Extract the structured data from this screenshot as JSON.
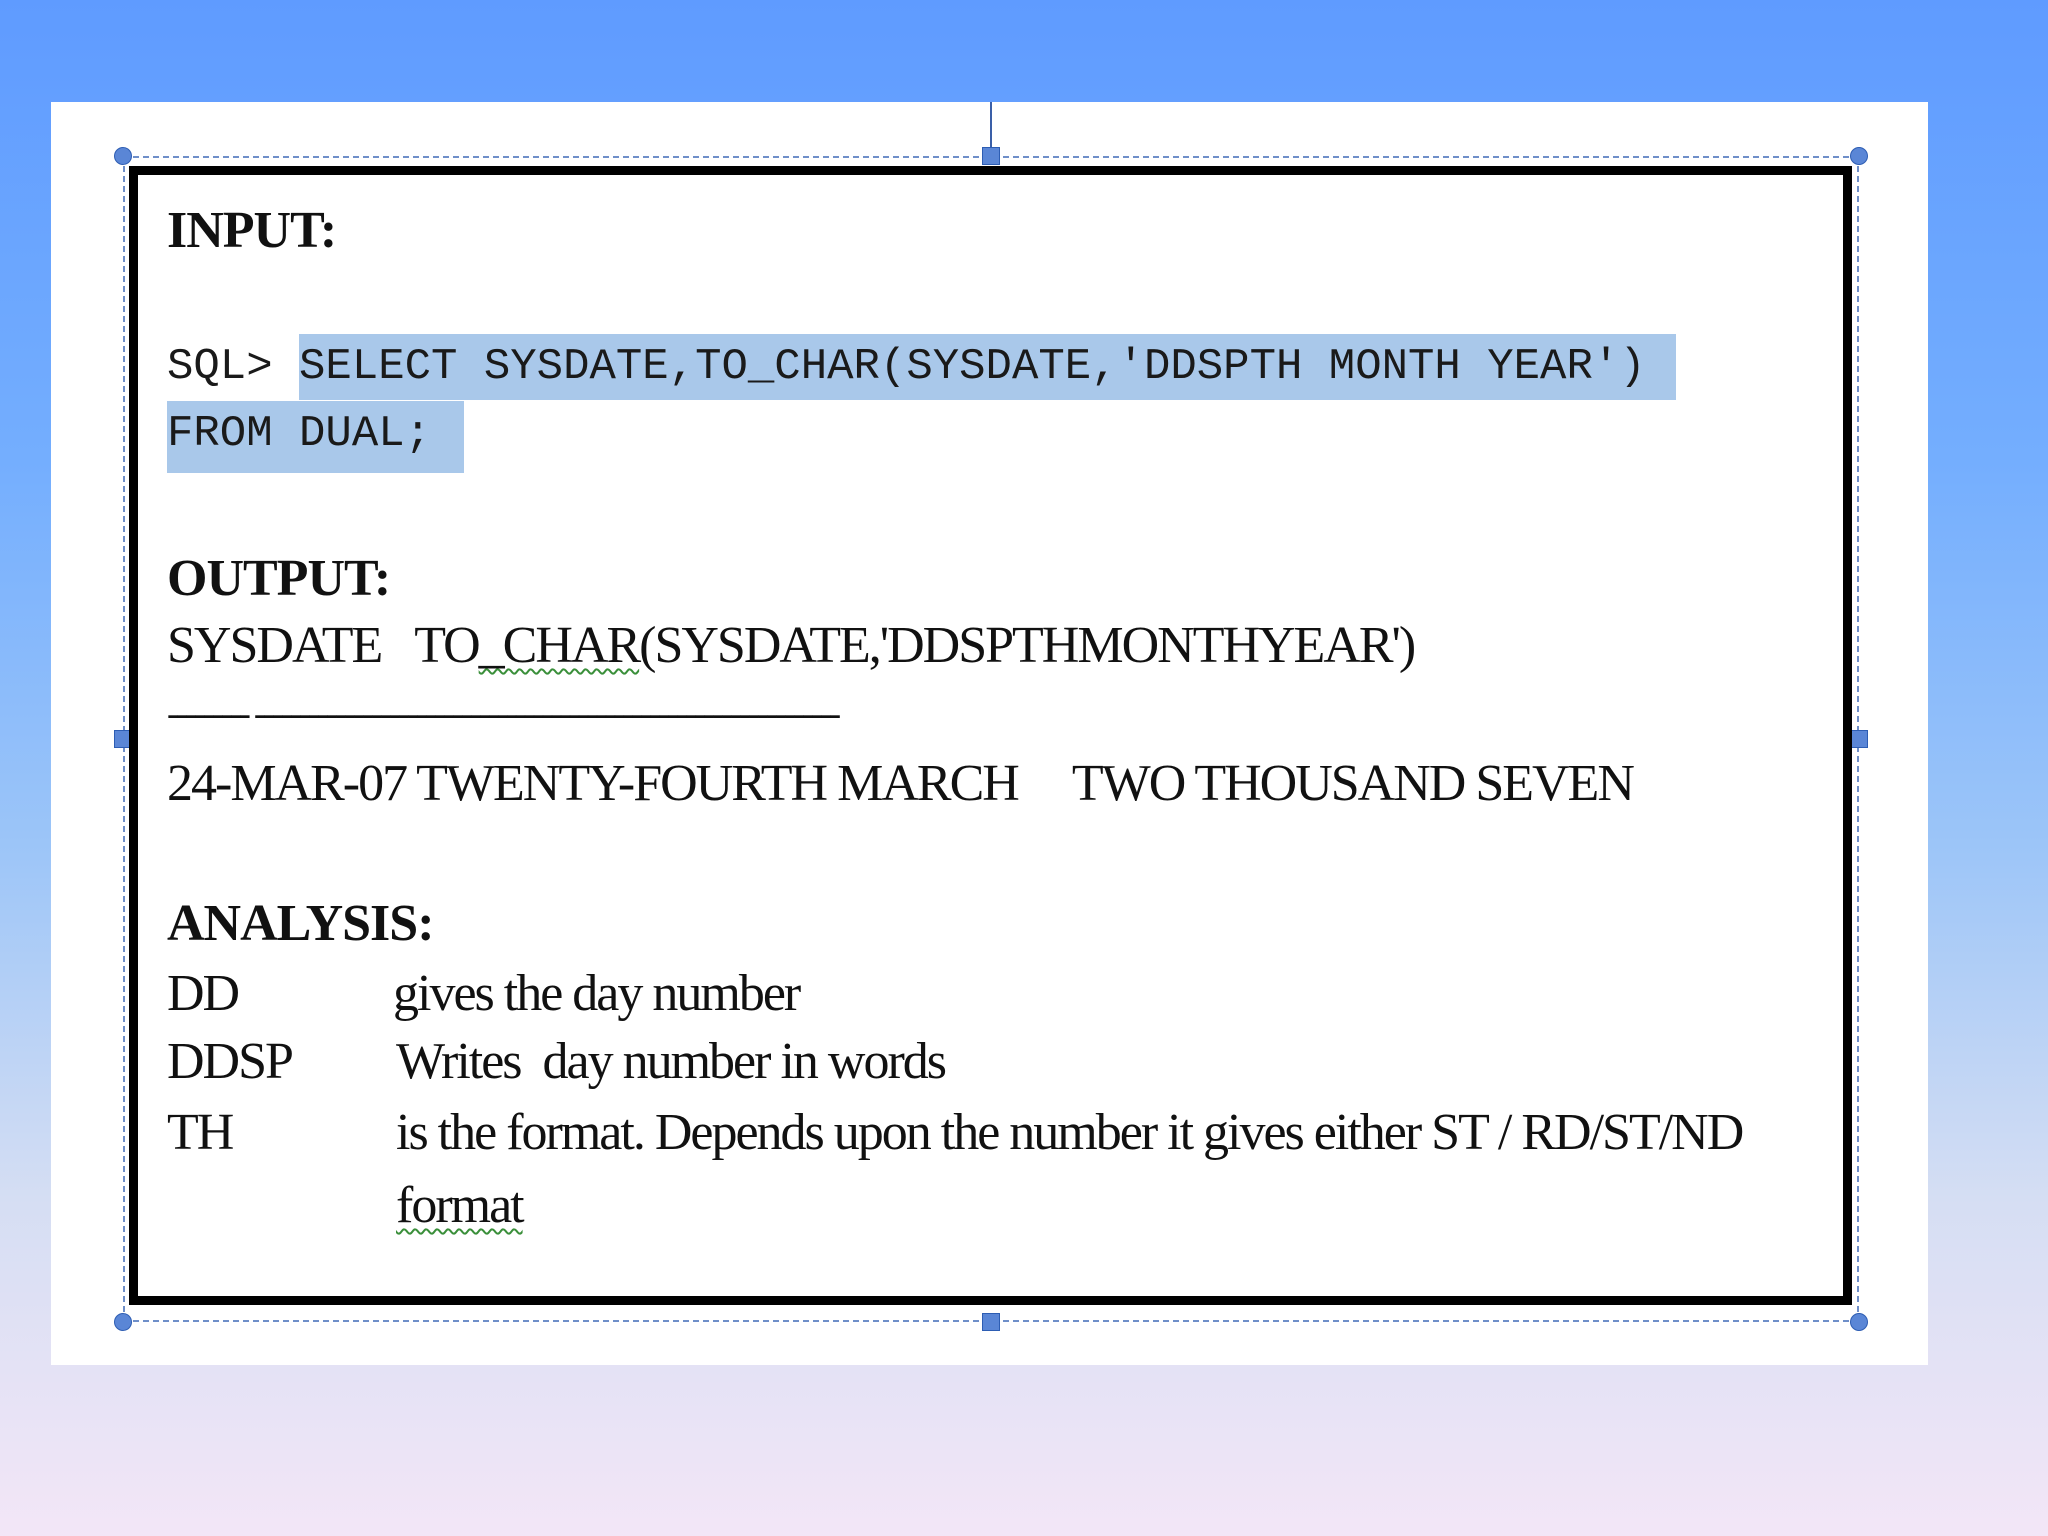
{
  "input_section": {
    "heading": "INPUT:",
    "prompt": "SQL> ",
    "query_line1": "SELECT SYSDATE,TO_CHAR(SYSDATE,'DDSPTH MONTH YEAR')",
    "query_line2": "FROM DUAL;"
  },
  "output_section": {
    "heading": "OUTPUT:",
    "column_header_a": "SYSDATE",
    "column_header_b_prefix": "TO",
    "column_header_b_squiggle": "_CHAR",
    "column_header_b_suffix": "(SYSDATE,'DDSPTHMONTHYEAR')",
    "separator": "--------- -----------------------------------------------------------------",
    "result_row": "24-MAR-07 TWENTY-FOURTH MARCH     TWO THOUSAND SEVEN"
  },
  "analysis_section": {
    "heading": "ANALYSIS:",
    "rows": [
      {
        "term": "DD",
        "desc": "gives the day number"
      },
      {
        "term": "DDSP",
        "desc": "Writes  day number in words"
      },
      {
        "term": "TH",
        "desc": "is the format. Depends upon the number it gives either ST / RD/ST/ND"
      }
    ],
    "continuation": "format"
  }
}
